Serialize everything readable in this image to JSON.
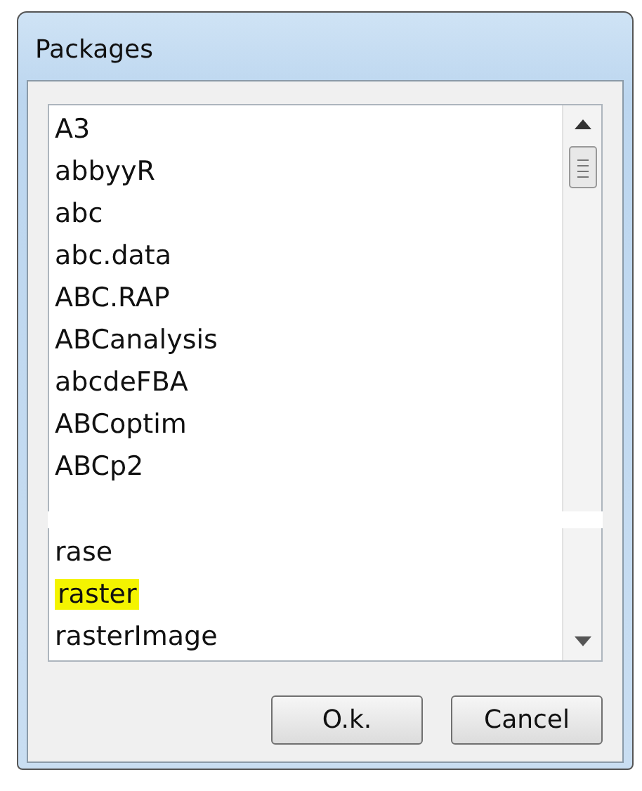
{
  "window": {
    "title": "Packages"
  },
  "list_segments": [
    {
      "items": [
        {
          "label": "A3",
          "highlighted": false
        },
        {
          "label": "abbyyR",
          "highlighted": false
        },
        {
          "label": "abc",
          "highlighted": false
        },
        {
          "label": "abc.data",
          "highlighted": false
        },
        {
          "label": "ABC.RAP",
          "highlighted": false
        },
        {
          "label": "ABCanalysis",
          "highlighted": false
        },
        {
          "label": "abcdeFBA",
          "highlighted": false
        },
        {
          "label": "ABCoptim",
          "highlighted": false
        },
        {
          "label": "ABCp2",
          "highlighted": false
        }
      ]
    },
    {
      "items": [
        {
          "label": "rase",
          "highlighted": false
        },
        {
          "label": "raster",
          "highlighted": true
        },
        {
          "label": "rasterImage",
          "highlighted": false
        }
      ]
    }
  ],
  "buttons": [
    "O.k.",
    "Cancel"
  ]
}
